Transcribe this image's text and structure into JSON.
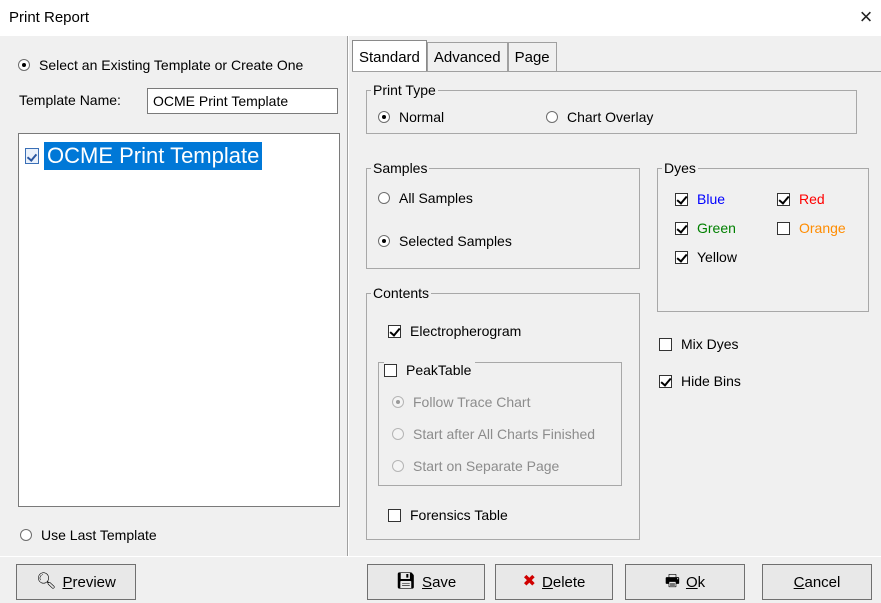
{
  "window": {
    "title": "Print Report",
    "close_label": "×"
  },
  "left": {
    "select_option_label": "Select an Existing Template or Create One",
    "template_name_label": "Template Name:",
    "template_name_value": "OCME Print Template",
    "tree_items": [
      "OCME Print Template"
    ],
    "use_last_label": "Use Last Template"
  },
  "tabs": [
    {
      "label": "Standard",
      "active": true
    },
    {
      "label": "Advanced",
      "active": false
    },
    {
      "label": "Page",
      "active": false
    }
  ],
  "standard": {
    "print_type": {
      "title": "Print Type",
      "normal_label": "Normal",
      "overlay_label": "Chart Overlay"
    },
    "samples": {
      "title": "Samples",
      "all_label": "All Samples",
      "selected_label": "Selected Samples"
    },
    "dyes": {
      "title": "Dyes",
      "items": [
        {
          "label": "Blue",
          "checked": true,
          "color": "#0000ff"
        },
        {
          "label": "Red",
          "checked": true,
          "color": "#ff0000"
        },
        {
          "label": "Green",
          "checked": true,
          "color": "#008000"
        },
        {
          "label": "Orange",
          "checked": false,
          "color": "#ff8c00"
        },
        {
          "label": "Yellow",
          "checked": true,
          "color": "#000000"
        }
      ]
    },
    "contents": {
      "title": "Contents",
      "electropherogram_label": "Electropherogram",
      "peak_table_label": "PeakTable",
      "follow_trace_label": "Follow Trace Chart",
      "start_after_label": "Start after All Charts Finished",
      "start_separate_label": "Start on Separate Page",
      "forensics_label": "Forensics Table"
    },
    "mix_dyes_label": "Mix Dyes",
    "hide_bins_label": "Hide Bins"
  },
  "buttons": {
    "preview": {
      "pre": "",
      "u": "P",
      "post": "review"
    },
    "save": {
      "pre": "",
      "u": "S",
      "post": "ave"
    },
    "delete": {
      "pre": "",
      "u": "D",
      "post": "elete"
    },
    "ok": {
      "pre": "",
      "u": "O",
      "post": "k"
    },
    "cancel": {
      "pre": "",
      "u": "C",
      "post": "ancel"
    }
  }
}
